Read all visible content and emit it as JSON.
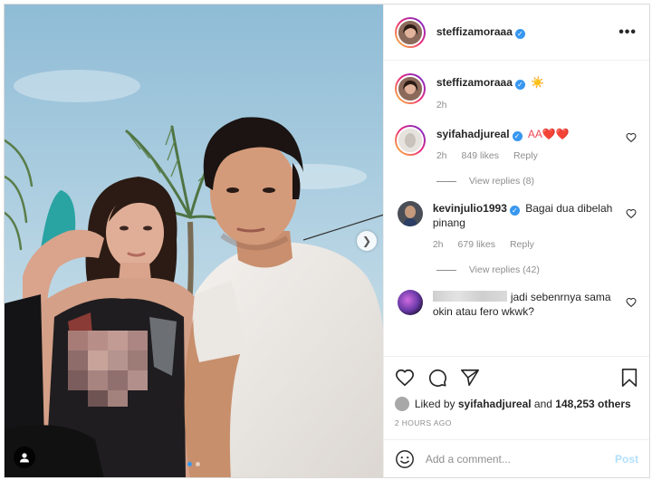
{
  "post": {
    "author": "steffizamoraaa",
    "menu_icon": "more-horizontal-icon",
    "caption_emoji": "☀️",
    "caption_time": "2h",
    "media": {
      "next_icon": "chevron-right-icon",
      "tag_icon": "user-tag-icon",
      "carousel_index": 1,
      "carousel_count": 2
    }
  },
  "comments": [
    {
      "username": "syifahadjureal",
      "verified": true,
      "text": "AA❤️❤️",
      "time": "2h",
      "likes": "849 likes",
      "reply_label": "Reply",
      "view_replies": "View replies (8)"
    },
    {
      "username": "kevinjulio1993",
      "verified": true,
      "text": "Bagai dua dibelah pinang",
      "time": "2h",
      "likes": "679 likes",
      "reply_label": "Reply",
      "view_replies": "View replies (42)"
    },
    {
      "username": "",
      "verified": false,
      "text": "jadi sebenrnya sama okin atau fero wkwk?"
    }
  ],
  "actions": {
    "like_icon": "heart-icon",
    "comment_icon": "comment-icon",
    "share_icon": "send-icon",
    "save_icon": "bookmark-icon",
    "liked_by_prefix": "Liked by",
    "liked_by_user": "syifahadjureal",
    "liked_by_and": "and",
    "liked_by_others": "148,253 others",
    "time_ago": "2 HOURS AGO"
  },
  "add_comment": {
    "emoji_icon": "smiley-icon",
    "placeholder": "Add a comment...",
    "post_label": "Post"
  },
  "colors": {
    "accent": "#3897f0",
    "post_disabled": "#b2dffc",
    "muted": "#8e8e8e",
    "heart_red": "#ed4956"
  }
}
